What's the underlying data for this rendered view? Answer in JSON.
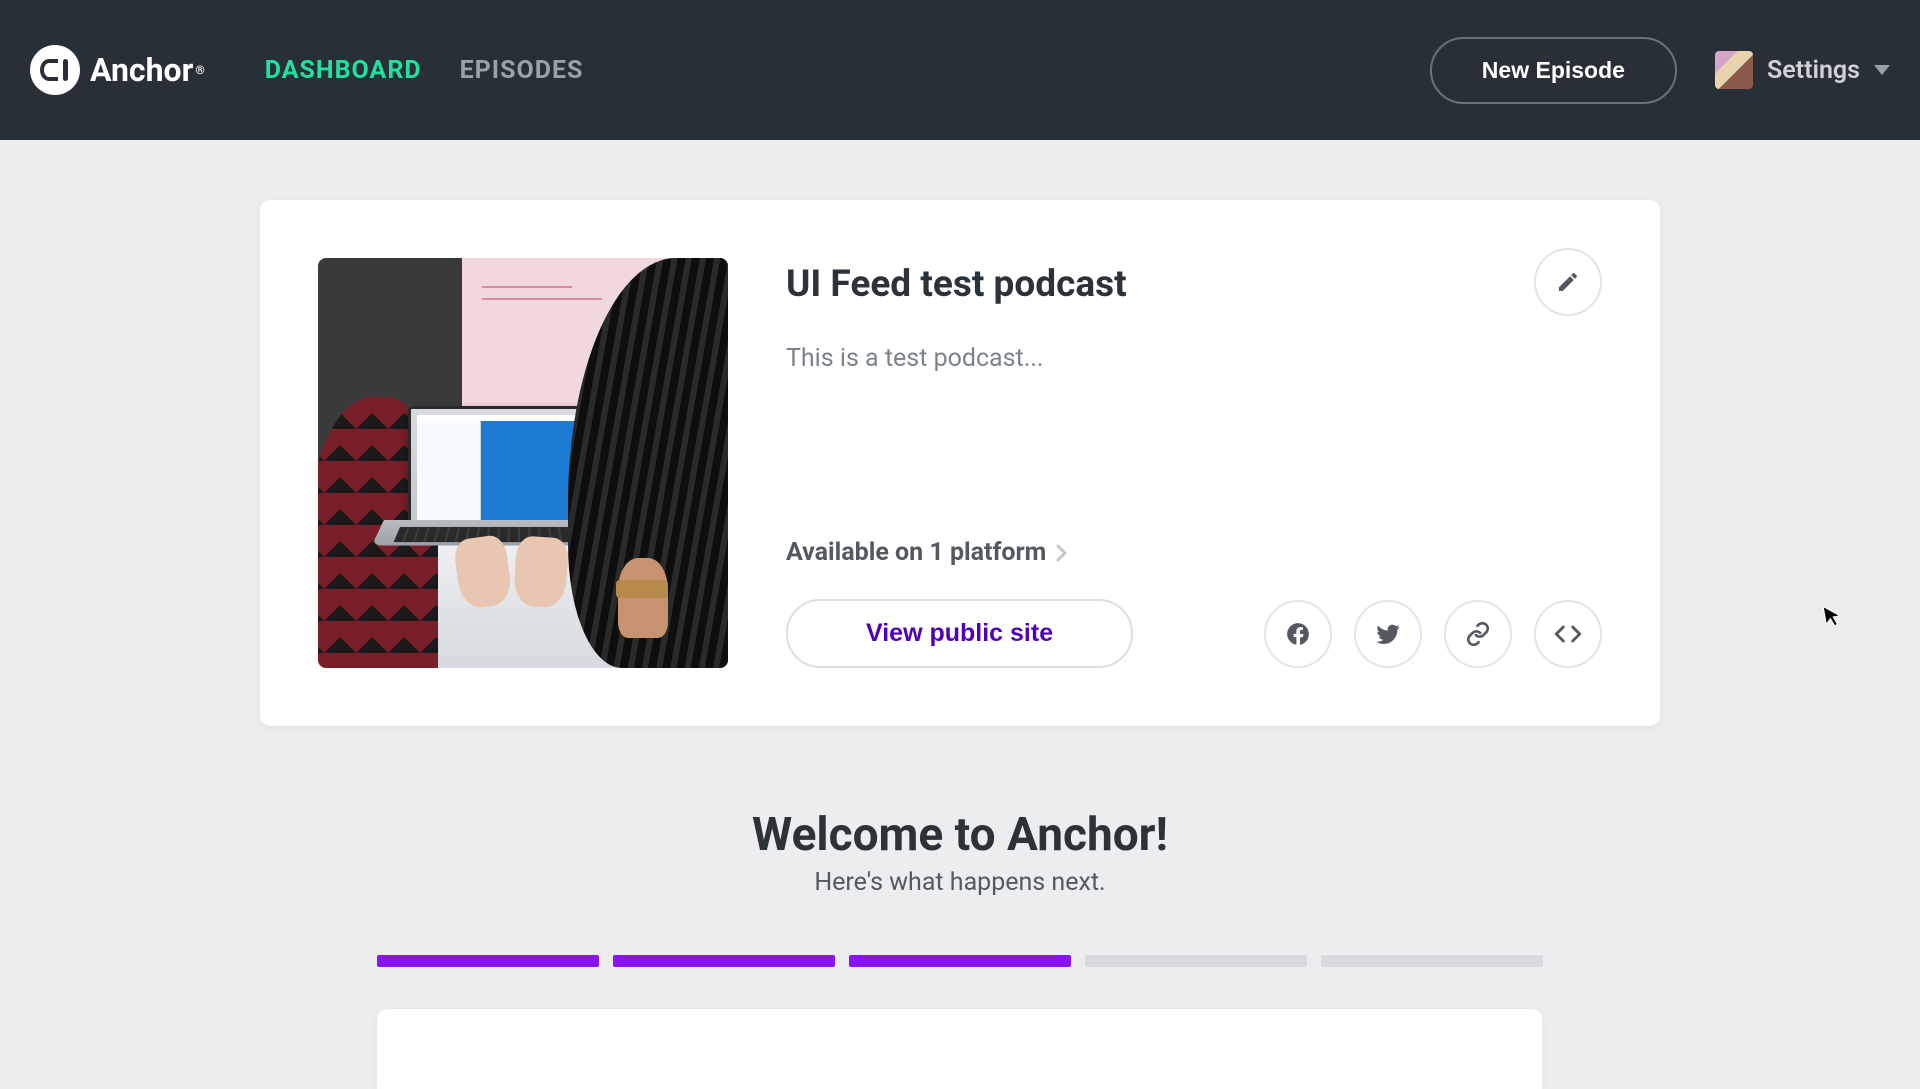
{
  "header": {
    "logo_text": "Anchor",
    "nav": {
      "dashboard": "DASHBOARD",
      "episodes": "EPISODES"
    },
    "new_episode": "New Episode",
    "settings_label": "Settings"
  },
  "podcast": {
    "title": "UI Feed test podcast",
    "description": "This is a test podcast...",
    "available_label": "Available on 1 platform",
    "view_public": "View public site"
  },
  "welcome": {
    "title": "Welcome to Anchor!",
    "subtitle": "Here's what happens next."
  },
  "progress": {
    "total_steps": 5,
    "completed_steps": 3
  },
  "colors": {
    "accent_green": "#24e09e",
    "accent_purple": "#8913f4",
    "link_purple": "#5000b9",
    "header_bg": "#282f36"
  }
}
